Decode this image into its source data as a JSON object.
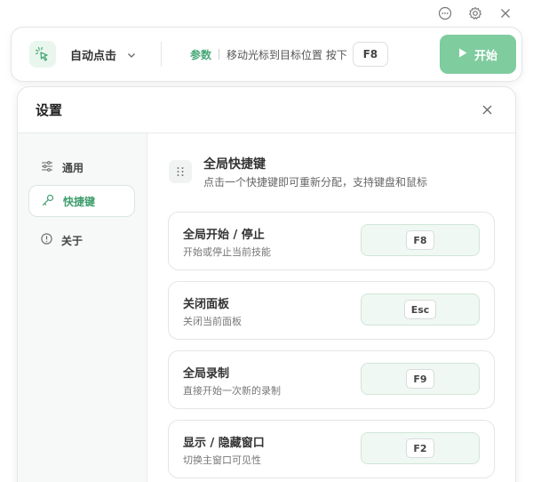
{
  "window_controls": {
    "icons": [
      "chat-icon",
      "gear-icon",
      "close-icon"
    ]
  },
  "topbar": {
    "app_icon": "cursor-click-icon",
    "mode_label": "自动点击",
    "param_label": "参数",
    "hint_text": "移动光标到目标位置 按下",
    "hint_key": "F8",
    "start_label": "开始"
  },
  "settings": {
    "title": "设置",
    "nav": [
      {
        "label": "通用",
        "icon": "sliders-icon",
        "active": false
      },
      {
        "label": "快捷键",
        "icon": "key-icon",
        "active": true
      },
      {
        "label": "关于",
        "icon": "info-icon",
        "active": false
      }
    ],
    "section": {
      "title": "全局快捷键",
      "description": "点击一个快捷键即可重新分配，支持键盘和鼠标"
    },
    "hotkeys": [
      {
        "name": "全局开始 / 停止",
        "desc": "开始或停止当前技能",
        "key": "F8"
      },
      {
        "name": "关闭面板",
        "desc": "关闭当前面板",
        "key": "Esc"
      },
      {
        "name": "全局录制",
        "desc": "直接开始一次新的录制",
        "key": "F9"
      },
      {
        "name": "显示 / 隐藏窗口",
        "desc": "切换主窗口可见性",
        "key": "F2"
      }
    ]
  },
  "colors": {
    "accent": "#4aa878",
    "start_button": "#7fcc9f",
    "hotkey_field_bg": "#f0f8f3"
  }
}
